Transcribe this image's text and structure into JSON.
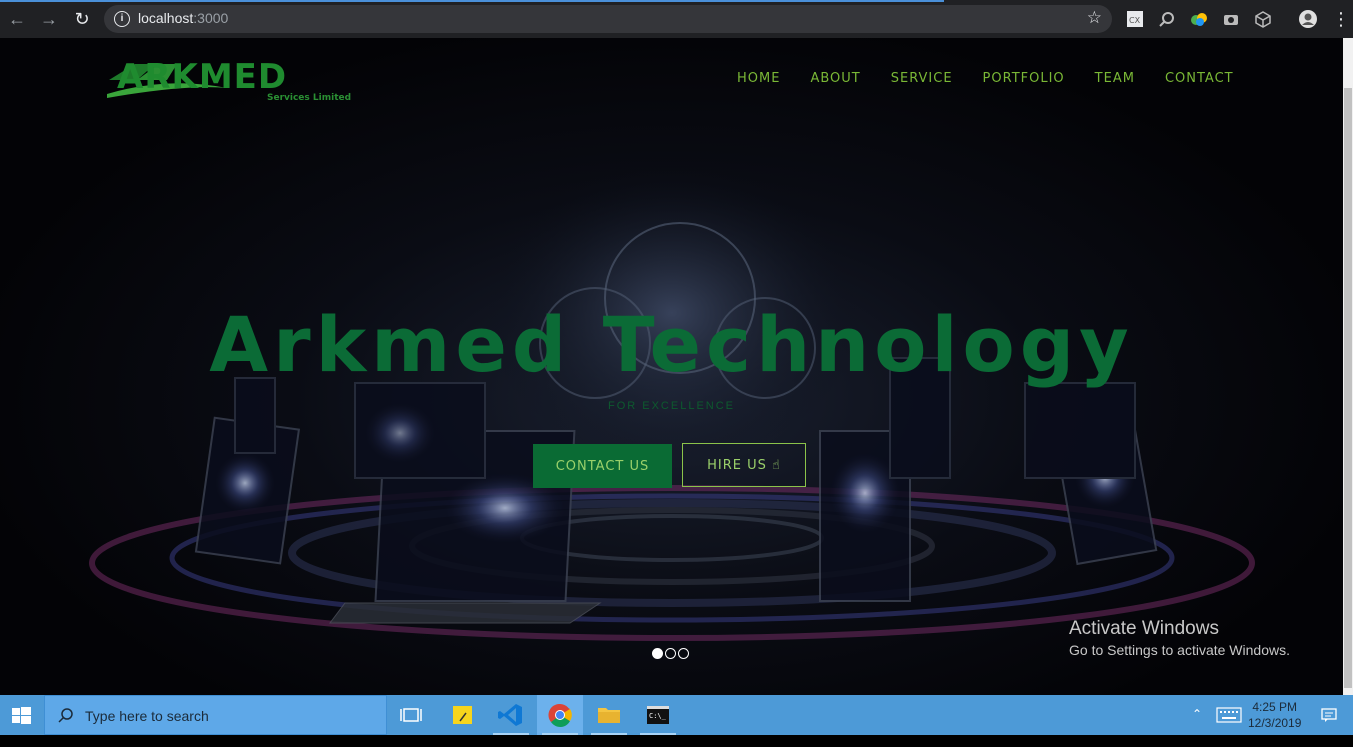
{
  "browser": {
    "url_host": "localhost",
    "url_port": ":3000"
  },
  "site": {
    "logo_text": "ARKMED",
    "logo_sub": "Services Limited",
    "nav": [
      "HOME",
      "ABOUT",
      "SERVICE",
      "PORTFOLIO",
      "TEAM",
      "CONTACT"
    ],
    "hero_title": "Arkmed Technology",
    "hero_subtitle": "FOR EXCELLENCE",
    "contact_btn": "CONTACT US",
    "hire_btn": "HIRE US",
    "slides_active": 1
  },
  "watermark": {
    "title": "Activate Windows",
    "subtitle": "Go to Settings to activate Windows."
  },
  "taskbar": {
    "search_placeholder": "Type here to search",
    "time": "4:25 PM",
    "date": "12/3/2019"
  },
  "colors": {
    "accent_green": "#0b6b36",
    "nav_green": "#7ab836",
    "taskbar_blue": "#4d9ad7"
  }
}
